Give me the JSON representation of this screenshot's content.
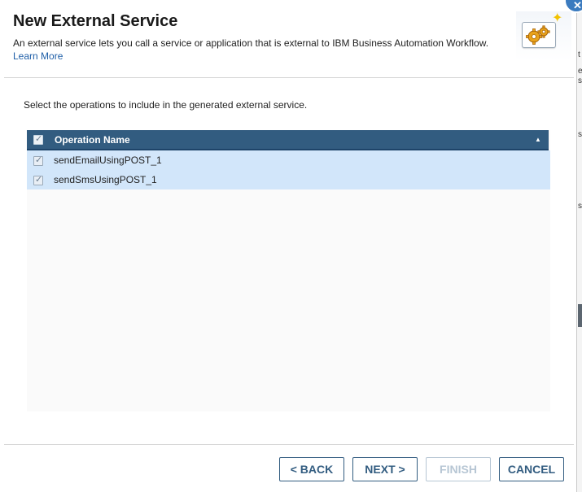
{
  "dialog": {
    "title": "New External Service",
    "description": "An external service lets you call a service or application that is external to IBM Business Automation Workflow.",
    "learn_more": "Learn More",
    "header_icon": "gears-icon"
  },
  "content": {
    "instruction": "Select the operations to include in the generated external service.",
    "table": {
      "header": "Operation Name",
      "select_all_checked": true,
      "sort": "ascending",
      "rows": [
        {
          "label": "sendEmailUsingPOST_1",
          "checked": true
        },
        {
          "label": "sendSmsUsingPOST_1",
          "checked": true
        }
      ]
    }
  },
  "footer": {
    "back_label": "< BACK",
    "next_label": "NEXT >",
    "finish_label": "FINISH",
    "finish_enabled": false,
    "cancel_label": "CANCEL"
  },
  "colors": {
    "header_bg": "#325c80",
    "row_selected_bg": "#d2e6fa",
    "link": "#1f5fa8",
    "button_border": "#325c80"
  },
  "icons": {
    "close": "close-icon",
    "sort": "sort-ascending-icon",
    "check": "check-icon"
  }
}
